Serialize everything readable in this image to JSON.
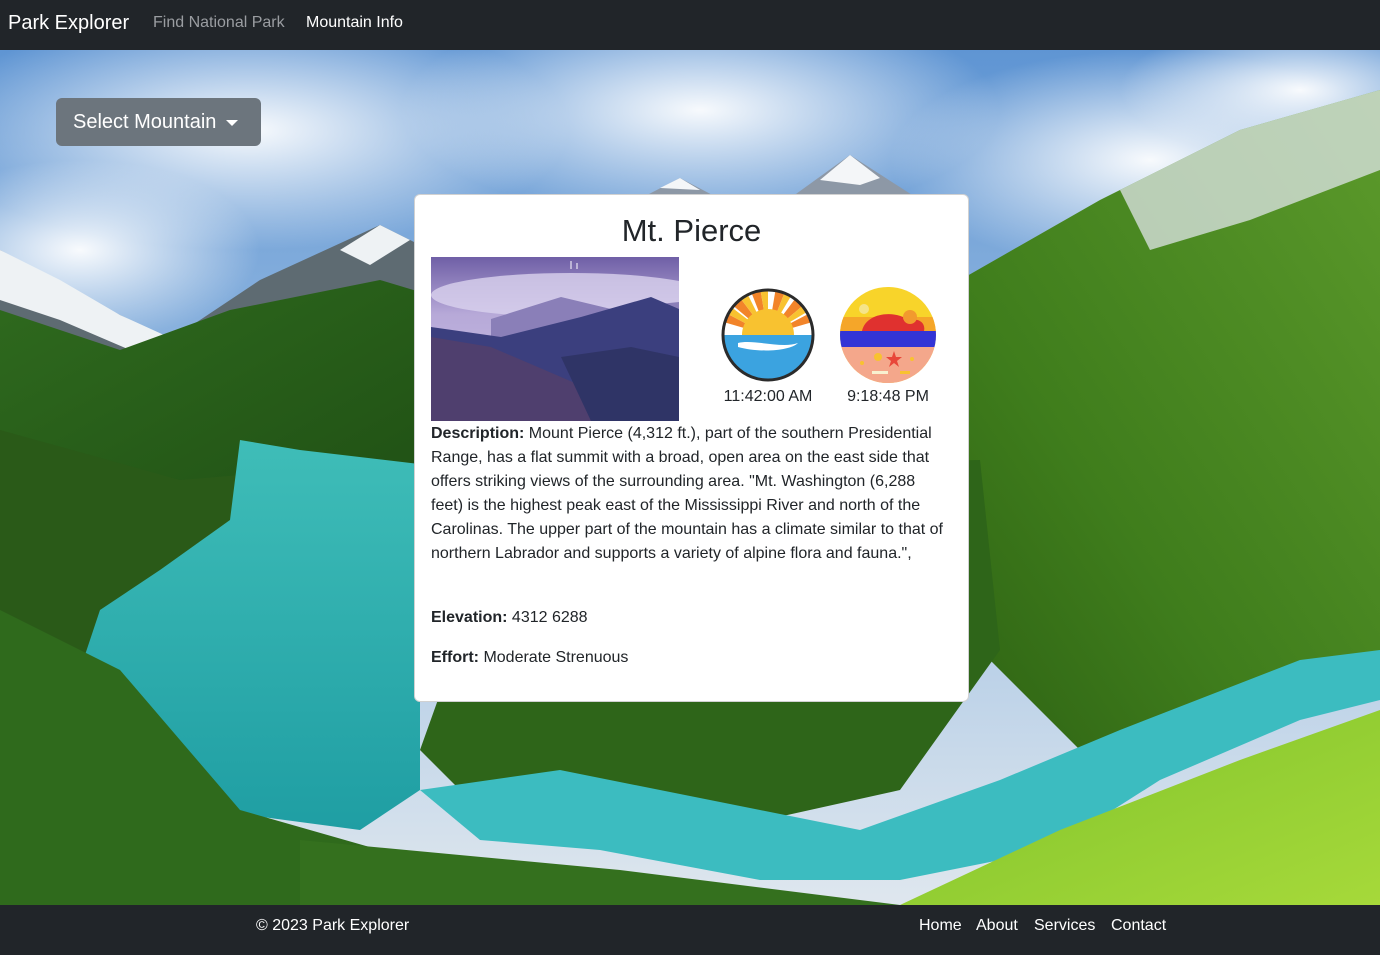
{
  "navbar": {
    "brand": "Park Explorer",
    "links": [
      {
        "label": "Find National Park",
        "active": false
      },
      {
        "label": "Mountain Info",
        "active": true
      }
    ]
  },
  "dropdown": {
    "label": "Select Mountain",
    "icon": "caret-down-icon"
  },
  "card": {
    "title": "Mt. Pierce",
    "sunrise_time": "11:42:00 AM",
    "sunset_time": "9:18:48 PM",
    "sunrise_icon": "sunrise-icon",
    "sunset_icon": "sunset-icon",
    "description_label": "Description:",
    "description": "Mount Pierce (4,312 ft.), part of the southern Presidential Range, has a flat summit with a broad, open area on the east side that offers striking views of the surrounding area. \"Mt. Washington (6,288 feet) is the highest peak east of the Mississippi River and north of the Carolinas. The upper part of the mountain has a climate similar to that of northern Labrador and supports a variety of alpine flora and fauna.\",",
    "elevation_label": "Elevation:",
    "elevation": "4312 6288",
    "effort_label": "Effort:",
    "effort": "Moderate Strenuous"
  },
  "footer": {
    "copyright": "© 2023 Park Explorer",
    "links": [
      "Home",
      "About",
      "Services",
      "Contact"
    ]
  },
  "colors": {
    "navbar_bg": "#212529",
    "button_bg": "#6c757d",
    "card_bg": "#ffffff",
    "text": "#212529",
    "nav_inactive": "#9a9da1"
  }
}
